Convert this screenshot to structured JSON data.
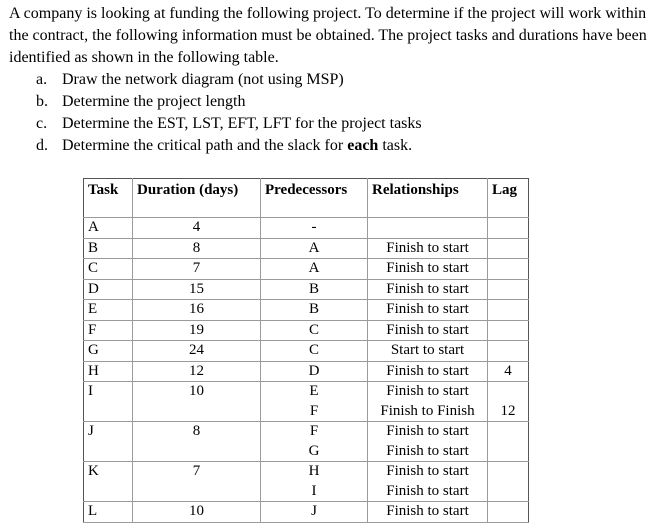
{
  "intro": "A company is looking at funding the following project.  To determine if the project will work within the contract, the following information must be obtained. The project tasks and durations have been identified as shown in the following table.",
  "questions": [
    {
      "marker": "a.",
      "text": "Draw the network diagram (not using MSP)"
    },
    {
      "marker": "b.",
      "text": "Determine the project length"
    },
    {
      "marker": "c.",
      "text": "Determine the EST, LST, EFT, LFT for the project tasks"
    },
    {
      "marker": "d.",
      "text_before": "Determine the critical path and the slack for ",
      "text_bold": "each",
      "text_after": " task."
    }
  ],
  "table": {
    "headers": [
      "Task",
      "Duration (days)",
      "Predecessors",
      "Relationships",
      "Lag"
    ],
    "rows": [
      {
        "task": "A",
        "duration": "4",
        "deps": [
          {
            "pred": "-",
            "rel": "",
            "lag": ""
          }
        ]
      },
      {
        "task": "B",
        "duration": "8",
        "deps": [
          {
            "pred": "A",
            "rel": "Finish to start",
            "lag": ""
          }
        ]
      },
      {
        "task": "C",
        "duration": "7",
        "deps": [
          {
            "pred": "A",
            "rel": "Finish to start",
            "lag": ""
          }
        ]
      },
      {
        "task": "D",
        "duration": "15",
        "deps": [
          {
            "pred": "B",
            "rel": "Finish to start",
            "lag": ""
          }
        ]
      },
      {
        "task": "E",
        "duration": "16",
        "deps": [
          {
            "pred": "B",
            "rel": "Finish to start",
            "lag": ""
          }
        ]
      },
      {
        "task": "F",
        "duration": "19",
        "deps": [
          {
            "pred": "C",
            "rel": "Finish to start",
            "lag": ""
          }
        ]
      },
      {
        "task": "G",
        "duration": "24",
        "deps": [
          {
            "pred": "C",
            "rel": "Start to start",
            "lag": ""
          }
        ]
      },
      {
        "task": "H",
        "duration": "12",
        "deps": [
          {
            "pred": "D",
            "rel": "Finish to start",
            "lag": "4"
          }
        ]
      },
      {
        "task": "I",
        "duration": "10",
        "deps": [
          {
            "pred": "E",
            "rel": "Finish to start",
            "lag": ""
          },
          {
            "pred": "F",
            "rel": "Finish to Finish",
            "lag": "12"
          }
        ]
      },
      {
        "task": "J",
        "duration": "8",
        "deps": [
          {
            "pred": "F",
            "rel": "Finish to start",
            "lag": ""
          },
          {
            "pred": "G",
            "rel": "Finish to start",
            "lag": ""
          }
        ]
      },
      {
        "task": "K",
        "duration": "7",
        "deps": [
          {
            "pred": "H",
            "rel": "Finish to start",
            "lag": ""
          },
          {
            "pred": "I",
            "rel": "Finish to start",
            "lag": ""
          }
        ]
      },
      {
        "task": "L",
        "duration": "10",
        "deps": [
          {
            "pred": "J",
            "rel": "Finish to start",
            "lag": ""
          }
        ]
      }
    ]
  }
}
